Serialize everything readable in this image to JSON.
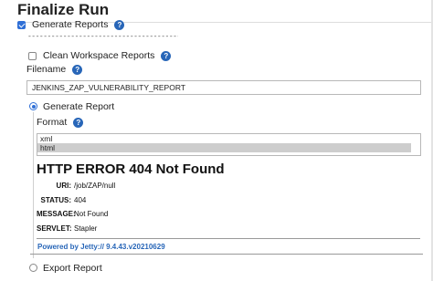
{
  "section": {
    "title": "Finalize Run"
  },
  "generate_reports": {
    "label": "Generate Reports",
    "checked": true
  },
  "separator_text": "---------------------------------------------------------------",
  "clean_workspace": {
    "label": "Clean Workspace Reports",
    "checked": false
  },
  "filename": {
    "label": "Filename",
    "value": "JENKINS_ZAP_VULNERABILITY_REPORT"
  },
  "generate_report": {
    "label": "Generate Report",
    "selected": true
  },
  "format": {
    "label": "Format",
    "options": [
      "xml",
      "html"
    ],
    "selected": "html"
  },
  "error": {
    "title": "HTTP ERROR 404 Not Found",
    "rows": [
      {
        "key": "URI:",
        "value": "/job/ZAP/null"
      },
      {
        "key": "STATUS:",
        "value": "404"
      },
      {
        "key": "MESSAGE:",
        "value": "Not Found"
      },
      {
        "key": "SERVLET:",
        "value": "Stapler"
      }
    ],
    "powered_by": "Powered by Jetty:// 9.4.43.v20210629"
  },
  "export_report": {
    "label": "Export Report",
    "selected": false
  },
  "colors": {
    "accent": "#2f6fd6",
    "help_icon": "#2866b8",
    "link": "#2866b8"
  }
}
